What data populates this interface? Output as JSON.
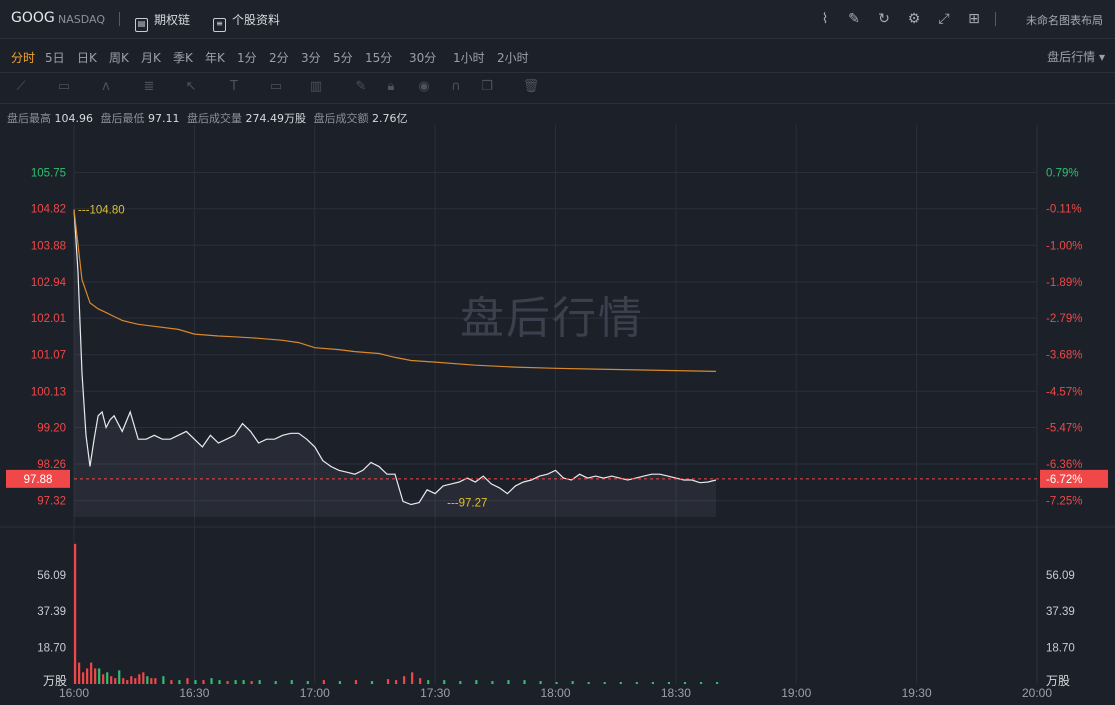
{
  "header": {
    "symbol": "GOOG",
    "exchange": "NASDAQ",
    "options_link": "期权链",
    "profile_link": "个股资料",
    "layout_name": "未命名图表布局",
    "icons": [
      "chart-icon",
      "draw-icon",
      "refresh-icon",
      "settings-icon",
      "fullscreen-icon",
      "layout-grid-icon"
    ]
  },
  "periods": [
    "分时",
    "5日",
    "日K",
    "周K",
    "月K",
    "季K",
    "年K",
    "1分",
    "2分",
    "3分",
    "5分",
    "15分",
    "30分",
    "1小时",
    "2小时"
  ],
  "active_period": "分时",
  "session_select": "盘后行情",
  "stats": {
    "high_label": "盘后最高",
    "high": "104.96",
    "low_label": "盘后最低",
    "low": "97.11",
    "vol_label": "盘后成交量",
    "vol": "274.49万股",
    "amount_label": "盘后成交额",
    "amount": "2.76亿"
  },
  "watermark": "盘后行情",
  "chart_data": {
    "type": "line",
    "x_ticks": [
      "16:00",
      "16:30",
      "17:00",
      "17:30",
      "18:00",
      "18:30",
      "19:00",
      "19:30",
      "20:00"
    ],
    "price_axis": {
      "ticks": [
        "105.75",
        "104.82",
        "103.88",
        "102.94",
        "102.01",
        "101.07",
        "100.13",
        "99.20",
        "98.26",
        "97.32"
      ],
      "tick_values": [
        105.75,
        104.82,
        103.88,
        102.94,
        102.01,
        101.07,
        100.13,
        99.2,
        98.26,
        97.32
      ],
      "tick_colors": [
        "#2fbf71",
        "#f04848",
        "#f04848",
        "#f04848",
        "#f04848",
        "#f04848",
        "#f04848",
        "#f04848",
        "#f04848",
        "#f04848"
      ],
      "pct_ticks": [
        "0.79%",
        "-0.11%",
        "-1.00%",
        "-1.89%",
        "-2.79%",
        "-3.68%",
        "-4.57%",
        "-5.47%",
        "-6.36%",
        "-7.25%"
      ],
      "pct_colors": [
        "#2fbf71",
        "#f04848",
        "#f04848",
        "#f04848",
        "#f04848",
        "#f04848",
        "#f04848",
        "#f04848",
        "#f04848",
        "#f04848"
      ],
      "ylim": [
        96.9,
        106.2
      ]
    },
    "current": {
      "price": "97.88",
      "pct": "-6.72%",
      "value": 97.88
    },
    "annotations": [
      {
        "label": "104.80",
        "time": "16:00",
        "value": 104.8
      },
      {
        "label": "97.27",
        "time": "17:32",
        "value": 97.27
      }
    ],
    "series": [
      {
        "color": "#e8eaee",
        "points": [
          [
            0,
            104.8
          ],
          [
            1,
            103.2
          ],
          [
            2,
            100.6
          ],
          [
            3,
            99.0
          ],
          [
            4,
            98.2
          ],
          [
            5,
            98.9
          ],
          [
            6,
            99.5
          ],
          [
            7,
            99.6
          ],
          [
            8,
            99.2
          ],
          [
            9,
            99.4
          ],
          [
            10,
            99.5
          ],
          [
            12,
            99.1
          ],
          [
            14,
            99.6
          ],
          [
            16,
            98.9
          ],
          [
            18,
            98.9
          ],
          [
            20,
            99.0
          ],
          [
            22,
            98.9
          ],
          [
            24,
            98.9
          ],
          [
            26,
            99.0
          ],
          [
            28,
            99.1
          ],
          [
            30,
            98.9
          ],
          [
            32,
            98.7
          ],
          [
            34,
            99.0
          ],
          [
            36,
            98.8
          ],
          [
            38,
            98.9
          ],
          [
            40,
            99.0
          ],
          [
            42,
            99.3
          ],
          [
            44,
            99.1
          ],
          [
            46,
            98.8
          ],
          [
            48,
            98.9
          ],
          [
            50,
            98.9
          ],
          [
            52,
            99.0
          ],
          [
            54,
            99.05
          ],
          [
            56,
            99.05
          ],
          [
            58,
            98.9
          ],
          [
            60,
            98.7
          ],
          [
            62,
            98.35
          ],
          [
            64,
            98.2
          ],
          [
            66,
            98.1
          ],
          [
            68,
            98.05
          ],
          [
            70,
            98.0
          ],
          [
            72,
            98.1
          ],
          [
            74,
            98.3
          ],
          [
            76,
            98.2
          ],
          [
            78,
            98.0
          ],
          [
            80,
            98.0
          ],
          [
            82,
            97.3
          ],
          [
            84,
            97.22
          ],
          [
            86,
            97.27
          ],
          [
            88,
            97.6
          ],
          [
            90,
            97.5
          ],
          [
            92,
            97.7
          ],
          [
            94,
            97.75
          ],
          [
            96,
            97.8
          ],
          [
            98,
            97.9
          ],
          [
            100,
            97.8
          ],
          [
            102,
            97.95
          ],
          [
            104,
            97.75
          ],
          [
            106,
            97.65
          ],
          [
            108,
            97.5
          ],
          [
            110,
            97.7
          ],
          [
            112,
            97.8
          ],
          [
            114,
            97.85
          ],
          [
            116,
            97.95
          ],
          [
            118,
            98.0
          ],
          [
            120,
            98.1
          ],
          [
            122,
            97.9
          ],
          [
            124,
            97.85
          ],
          [
            126,
            98.0
          ],
          [
            128,
            97.9
          ],
          [
            130,
            97.95
          ],
          [
            132,
            97.9
          ],
          [
            134,
            97.95
          ],
          [
            136,
            97.9
          ],
          [
            138,
            97.85
          ],
          [
            140,
            97.9
          ],
          [
            142,
            97.95
          ],
          [
            144,
            98.0
          ],
          [
            146,
            98.0
          ],
          [
            148,
            97.95
          ],
          [
            150,
            97.9
          ],
          [
            152,
            97.85
          ],
          [
            154,
            97.85
          ],
          [
            156,
            97.78
          ],
          [
            158,
            97.8
          ],
          [
            160,
            97.85
          ]
        ]
      },
      {
        "color": "#d9892b",
        "points": [
          [
            0,
            104.8
          ],
          [
            2,
            103.0
          ],
          [
            4,
            102.4
          ],
          [
            6,
            102.25
          ],
          [
            8,
            102.15
          ],
          [
            10,
            102.05
          ],
          [
            12,
            101.95
          ],
          [
            14,
            101.9
          ],
          [
            16,
            101.85
          ],
          [
            20,
            101.8
          ],
          [
            26,
            101.72
          ],
          [
            30,
            101.6
          ],
          [
            36,
            101.55
          ],
          [
            40,
            101.53
          ],
          [
            46,
            101.49
          ],
          [
            52,
            101.44
          ],
          [
            56,
            101.38
          ],
          [
            60,
            101.25
          ],
          [
            66,
            101.2
          ],
          [
            70,
            101.15
          ],
          [
            76,
            101.1
          ],
          [
            80,
            101.0
          ],
          [
            84,
            100.92
          ],
          [
            90,
            100.88
          ],
          [
            100,
            100.8
          ],
          [
            110,
            100.75
          ],
          [
            120,
            100.72
          ],
          [
            130,
            100.7
          ],
          [
            140,
            100.68
          ],
          [
            150,
            100.66
          ],
          [
            160,
            100.64
          ]
        ]
      }
    ],
    "volume": {
      "ticks": [
        "56.09",
        "37.39",
        "18.70"
      ],
      "tick_values": [
        56.09,
        37.39,
        18.7
      ],
      "unit": "万股",
      "ylim": [
        0,
        75
      ],
      "up_color": "#2fbf71",
      "down_color": "#f04848",
      "bars": [
        [
          0,
          72,
          "down"
        ],
        [
          1,
          11,
          "down"
        ],
        [
          2,
          6,
          "down"
        ],
        [
          3,
          8,
          "down"
        ],
        [
          4,
          11,
          "down"
        ],
        [
          5,
          8,
          "down"
        ],
        [
          6,
          8,
          "up"
        ],
        [
          7,
          5,
          "down"
        ],
        [
          8,
          6,
          "up"
        ],
        [
          9,
          4,
          "down"
        ],
        [
          10,
          3,
          "down"
        ],
        [
          11,
          7,
          "up"
        ],
        [
          12,
          3,
          "down"
        ],
        [
          13,
          2,
          "down"
        ],
        [
          14,
          4,
          "down"
        ],
        [
          15,
          3,
          "down"
        ],
        [
          16,
          5,
          "down"
        ],
        [
          17,
          6,
          "down"
        ],
        [
          18,
          4,
          "up"
        ],
        [
          19,
          3,
          "down"
        ],
        [
          20,
          3,
          "down"
        ],
        [
          22,
          4,
          "up"
        ],
        [
          24,
          2,
          "down"
        ],
        [
          26,
          2,
          "up"
        ],
        [
          28,
          3,
          "down"
        ],
        [
          30,
          2,
          "up"
        ],
        [
          32,
          2,
          "down"
        ],
        [
          34,
          3,
          "up"
        ],
        [
          36,
          2,
          "up"
        ],
        [
          38,
          1.5,
          "down"
        ],
        [
          40,
          2,
          "up"
        ],
        [
          42,
          2,
          "up"
        ],
        [
          44,
          1.5,
          "down"
        ],
        [
          46,
          2,
          "up"
        ],
        [
          50,
          1.5,
          "up"
        ],
        [
          54,
          2,
          "up"
        ],
        [
          58,
          1.5,
          "up"
        ],
        [
          62,
          2,
          "down"
        ],
        [
          66,
          1.5,
          "up"
        ],
        [
          70,
          2,
          "down"
        ],
        [
          74,
          1.5,
          "up"
        ],
        [
          78,
          2.5,
          "down"
        ],
        [
          80,
          2,
          "down"
        ],
        [
          82,
          4,
          "down"
        ],
        [
          84,
          6,
          "down"
        ],
        [
          86,
          3,
          "down"
        ],
        [
          88,
          2,
          "up"
        ],
        [
          92,
          2,
          "up"
        ],
        [
          96,
          1.5,
          "up"
        ],
        [
          100,
          2,
          "up"
        ],
        [
          104,
          1.5,
          "up"
        ],
        [
          108,
          2,
          "up"
        ],
        [
          112,
          2,
          "up"
        ],
        [
          116,
          1.5,
          "up"
        ],
        [
          120,
          1,
          "up"
        ],
        [
          124,
          1.5,
          "up"
        ],
        [
          128,
          1,
          "up"
        ],
        [
          132,
          1,
          "up"
        ],
        [
          136,
          1,
          "up"
        ],
        [
          140,
          1,
          "up"
        ],
        [
          144,
          1,
          "up"
        ],
        [
          148,
          1,
          "up"
        ],
        [
          152,
          1,
          "up"
        ],
        [
          156,
          1,
          "up"
        ],
        [
          160,
          1,
          "up"
        ]
      ]
    }
  }
}
